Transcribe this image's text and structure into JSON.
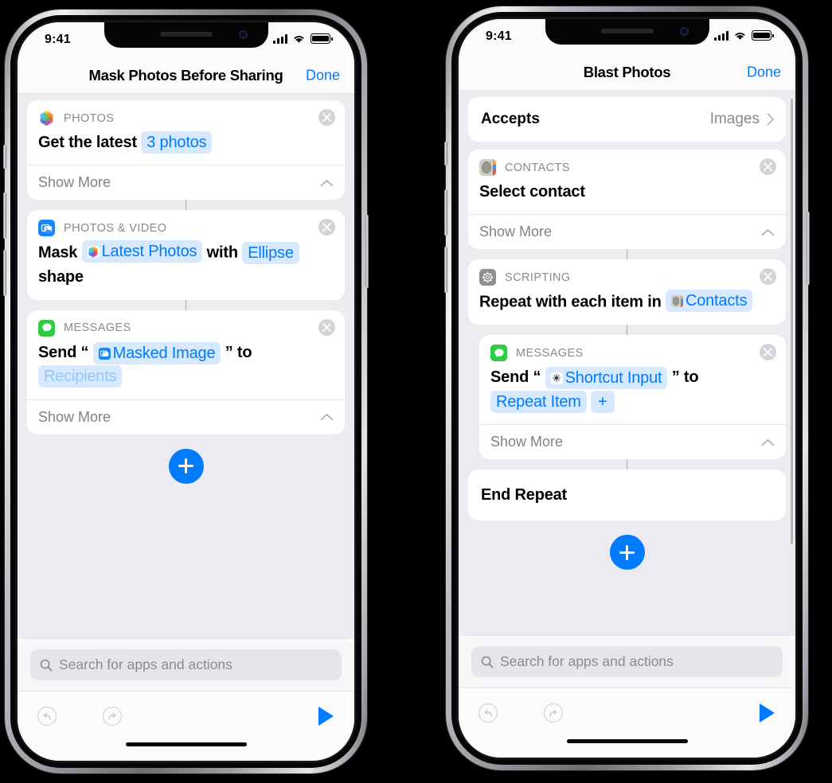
{
  "colors": {
    "accent": "#007aff",
    "token_bg": "#d6e9fe",
    "token_text": "#007aff",
    "token_dim_text": "#96c5f7",
    "page_bg": "#ececf0",
    "card_bg": "#ffffff",
    "category_text": "#8a8a8f",
    "messages_green": "#2ecc42",
    "photosvideo_blue": "#1787fb",
    "scripting_gray": "#8e8e93"
  },
  "phones": [
    {
      "id": "left",
      "status": {
        "time": "9:41",
        "signal_icon": "cellular-bars-icon",
        "wifi_icon": "wifi-icon",
        "battery_icon": "battery-full-icon"
      },
      "nav": {
        "title": "Mask Photos Before Sharing",
        "done_label": "Done"
      },
      "cards": [
        {
          "kind": "action",
          "icon": "photos-app-icon",
          "category": "PHOTOS",
          "close_icon": "close-circle-icon",
          "text_parts": [
            {
              "type": "text",
              "value": "Get the latest"
            },
            {
              "type": "token",
              "value": "3 photos",
              "style": "var"
            }
          ],
          "show_more": {
            "label": "Show More",
            "chevron_icon": "chevron-up-icon"
          }
        },
        {
          "kind": "action",
          "icon": "photos-and-video-icon",
          "category": "PHOTOS & VIDEO",
          "close_icon": "close-circle-icon",
          "text_parts": [
            {
              "type": "text",
              "value": "Mask"
            },
            {
              "type": "token",
              "value": "Latest Photos",
              "style": "var",
              "token_icon": "photos-app-icon"
            },
            {
              "type": "text",
              "value": "with"
            },
            {
              "type": "token",
              "value": "Ellipse",
              "style": "var"
            },
            {
              "type": "text",
              "value": "shape"
            }
          ],
          "show_more": null
        },
        {
          "kind": "action",
          "icon": "messages-app-icon",
          "category": "MESSAGES",
          "close_icon": "close-circle-icon",
          "text_parts": [
            {
              "type": "text",
              "value": "Send “"
            },
            {
              "type": "token",
              "value": "Masked Image",
              "style": "var",
              "token_icon": "photos-and-video-icon"
            },
            {
              "type": "text",
              "value": "” to"
            },
            {
              "type": "token",
              "value": "Recipients",
              "style": "dim"
            }
          ],
          "show_more": {
            "label": "Show More",
            "chevron_icon": "chevron-up-icon"
          }
        }
      ],
      "add_button": {
        "icon": "plus-icon"
      },
      "search": {
        "placeholder": "Search for apps and actions",
        "icon": "search-icon"
      },
      "toolbar": {
        "undo_icon": "undo-icon",
        "redo_icon": "redo-icon",
        "play_icon": "play-icon"
      }
    },
    {
      "id": "right",
      "status": {
        "time": "9:41",
        "signal_icon": "cellular-bars-icon",
        "wifi_icon": "wifi-icon",
        "battery_icon": "battery-full-icon"
      },
      "nav": {
        "title": "Blast Photos",
        "done_label": "Done"
      },
      "accepts": {
        "label": "Accepts",
        "value": "Images",
        "chevron_icon": "chevron-right-icon"
      },
      "cards": [
        {
          "kind": "action",
          "icon": "contacts-app-icon",
          "category": "CONTACTS",
          "close_icon": "close-circle-icon",
          "text_parts": [
            {
              "type": "text",
              "value": "Select contact"
            }
          ],
          "show_more": {
            "label": "Show More",
            "chevron_icon": "chevron-up-icon"
          }
        },
        {
          "kind": "action",
          "icon": "scripting-icon",
          "category": "SCRIPTING",
          "close_icon": "close-circle-icon",
          "text_parts": [
            {
              "type": "text",
              "value": "Repeat with each item in"
            },
            {
              "type": "token",
              "value": "Contacts",
              "style": "var",
              "token_icon": "contacts-app-icon"
            }
          ],
          "show_more": null
        },
        {
          "kind": "action-nested",
          "icon": "messages-app-icon",
          "category": "MESSAGES",
          "close_icon": "close-circle-icon",
          "text_parts": [
            {
              "type": "text",
              "value": "Send “"
            },
            {
              "type": "token",
              "value": "Shortcut Input",
              "style": "var",
              "token_icon": "shortcut-input-icon"
            },
            {
              "type": "text",
              "value": "” to"
            },
            {
              "type": "token",
              "value": "Repeat Item",
              "style": "var"
            },
            {
              "type": "token",
              "value": "+",
              "style": "plus"
            }
          ],
          "show_more": {
            "label": "Show More",
            "chevron_icon": "chevron-up-icon"
          }
        },
        {
          "kind": "plain",
          "text_parts": [
            {
              "type": "text",
              "value": "End Repeat"
            }
          ]
        }
      ],
      "add_button": {
        "icon": "plus-icon"
      },
      "search": {
        "placeholder": "Search for apps and actions",
        "icon": "search-icon"
      },
      "toolbar": {
        "undo_icon": "undo-icon",
        "redo_icon": "redo-icon",
        "play_icon": "play-icon"
      }
    }
  ]
}
